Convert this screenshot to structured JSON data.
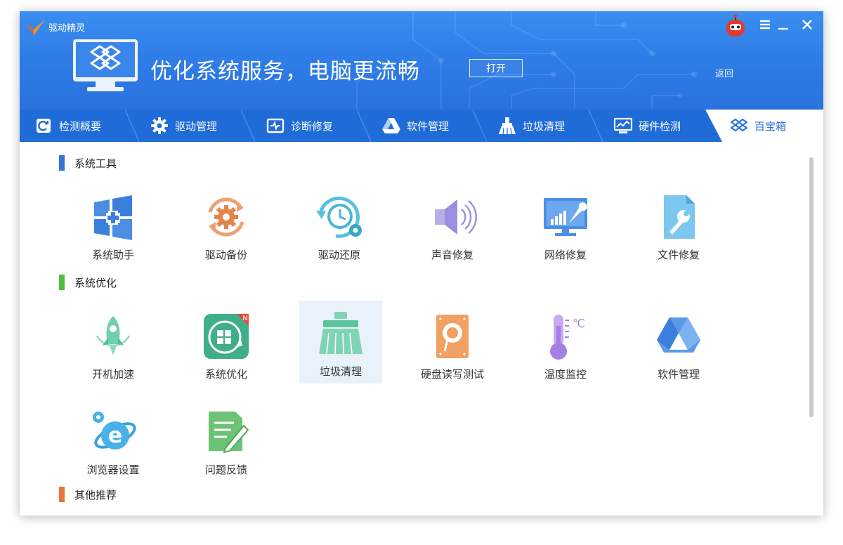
{
  "app": {
    "name": "驱动精灵"
  },
  "banner": {
    "title": "优化系统服务，电脑更流畅",
    "open_label": "打开",
    "back_label": "返回"
  },
  "tabs": [
    {
      "label": "检测概要",
      "icon": "refresh-icon"
    },
    {
      "label": "驱动管理",
      "icon": "gear-icon"
    },
    {
      "label": "诊断修复",
      "icon": "diagnose-icon"
    },
    {
      "label": "软件管理",
      "icon": "drive-icon"
    },
    {
      "label": "垃圾清理",
      "icon": "broom-icon"
    },
    {
      "label": "硬件检测",
      "icon": "monitor-chart-icon"
    },
    {
      "label": "百宝箱",
      "icon": "toolbox-icon",
      "active": true
    }
  ],
  "sections": [
    {
      "title": "系统工具",
      "color": "#3b73d6",
      "items": [
        {
          "label": "系统助手",
          "icon": "windows-tile-icon"
        },
        {
          "label": "驱动备份",
          "icon": "gear-cycle-icon"
        },
        {
          "label": "驱动还原",
          "icon": "clock-restore-icon"
        },
        {
          "label": "声音修复",
          "icon": "speaker-icon"
        },
        {
          "label": "网络修复",
          "icon": "network-monitor-icon"
        },
        {
          "label": "文件修复",
          "icon": "file-wrench-icon"
        }
      ]
    },
    {
      "title": "系统优化",
      "color": "#4cbf3c",
      "items": [
        {
          "label": "开机加速",
          "icon": "rocket-icon"
        },
        {
          "label": "系统优化",
          "icon": "windows-rocket-icon",
          "badge": "N"
        },
        {
          "label": "垃圾清理",
          "icon": "broom-icon",
          "selected": true
        },
        {
          "label": "硬盘读写测试",
          "icon": "hdd-icon"
        },
        {
          "label": "温度监控",
          "icon": "thermometer-icon",
          "unit": "℃"
        },
        {
          "label": "软件管理",
          "icon": "drive-icon"
        },
        {
          "label": "浏览器设置",
          "icon": "ie-icon"
        },
        {
          "label": "问题反馈",
          "icon": "note-pencil-icon"
        }
      ]
    },
    {
      "title": "其他推荐",
      "color": "#e8743b",
      "items": []
    }
  ],
  "colors": {
    "header_blue": "#2f7ee8",
    "tabbar_blue": "#1f6bd8",
    "selected_bg": "#e9f1fb"
  }
}
